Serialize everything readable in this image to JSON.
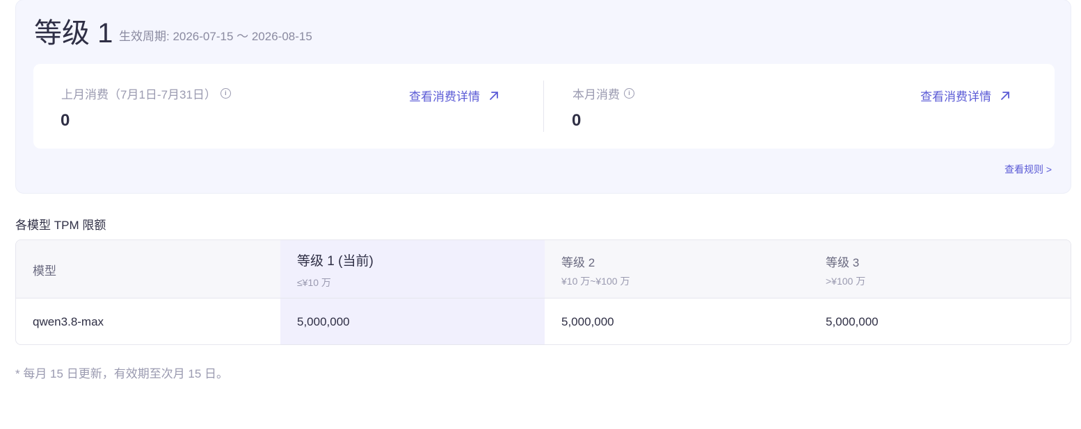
{
  "level": {
    "title": "等级 1",
    "period": "生效周期: 2026-07-15 ～ 2026-08-15"
  },
  "consumption": {
    "last_month": {
      "label": "上月消费（7月1日-7月31日）",
      "value": "0",
      "link": "查看消费详情"
    },
    "this_month": {
      "label": "本月消费",
      "value": "0",
      "link": "查看消费详情"
    },
    "info_glyph": "i",
    "rules_link": "查看规则 >"
  },
  "tpm": {
    "section_title": "各模型 TPM 限额",
    "columns": [
      {
        "label": "模型",
        "sub": ""
      },
      {
        "label": "等级 1 (当前)",
        "sub": "≤¥10 万"
      },
      {
        "label": "等级 2",
        "sub": "¥10 万~¥100 万"
      },
      {
        "label": "等级 3",
        "sub": ">¥100 万"
      }
    ],
    "rows": [
      {
        "model": "qwen3.8-max",
        "values": [
          "5,000,000",
          "5,000,000",
          "5,000,000"
        ]
      }
    ]
  },
  "footnote": "* 每月 15 日更新，有效期至次月 15 日。",
  "colors": {
    "accent": "#5b5bd6",
    "panel_bg": "#f5f6fe",
    "current_col_bg": "#f1f0fd"
  }
}
